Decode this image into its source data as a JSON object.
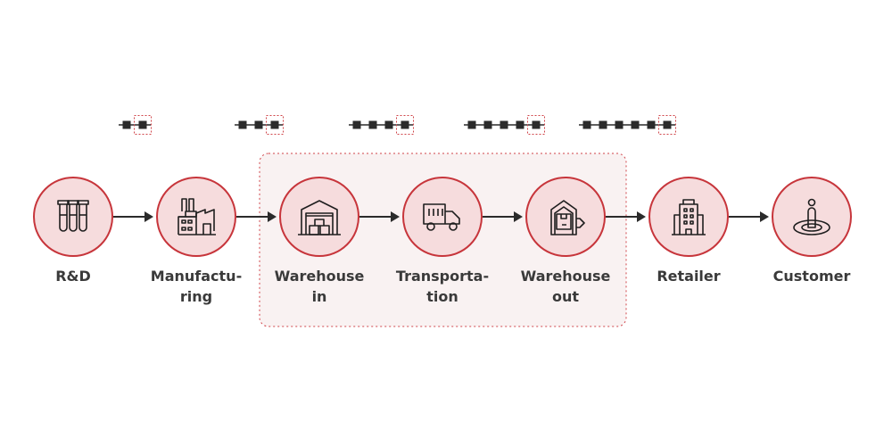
{
  "colors": {
    "circle_stroke": "#c7353b",
    "circle_fill": "#f6dcdd",
    "group_fill": "#f9f2f2",
    "group_border": "#d0444a",
    "ink": "#2b2b2b"
  },
  "chains": [
    {
      "blocks": 2,
      "highlighted": "last"
    },
    {
      "blocks": 3,
      "highlighted": "last"
    },
    {
      "blocks": 4,
      "highlighted": "last"
    },
    {
      "blocks": 5,
      "highlighted": "last"
    },
    {
      "blocks": 6,
      "highlighted": "last"
    }
  ],
  "steps": [
    {
      "line1": "R&D",
      "line2": "",
      "icon": "test-tubes-icon"
    },
    {
      "line1": "Manufactu-",
      "line2": "ring",
      "icon": "factory-icon"
    },
    {
      "line1": "Warehouse",
      "line2": "in",
      "icon": "warehouse-in-icon"
    },
    {
      "line1": "Transporta-",
      "line2": "tion",
      "icon": "truck-icon"
    },
    {
      "line1": "Warehouse",
      "line2": "out",
      "icon": "warehouse-out-icon"
    },
    {
      "line1": "Retailer",
      "line2": "",
      "icon": "building-icon"
    },
    {
      "line1": "Customer",
      "line2": "",
      "icon": "person-target-icon"
    }
  ],
  "group": {
    "members": [
      "Warehouse in",
      "Transportation",
      "Warehouse out"
    ]
  }
}
